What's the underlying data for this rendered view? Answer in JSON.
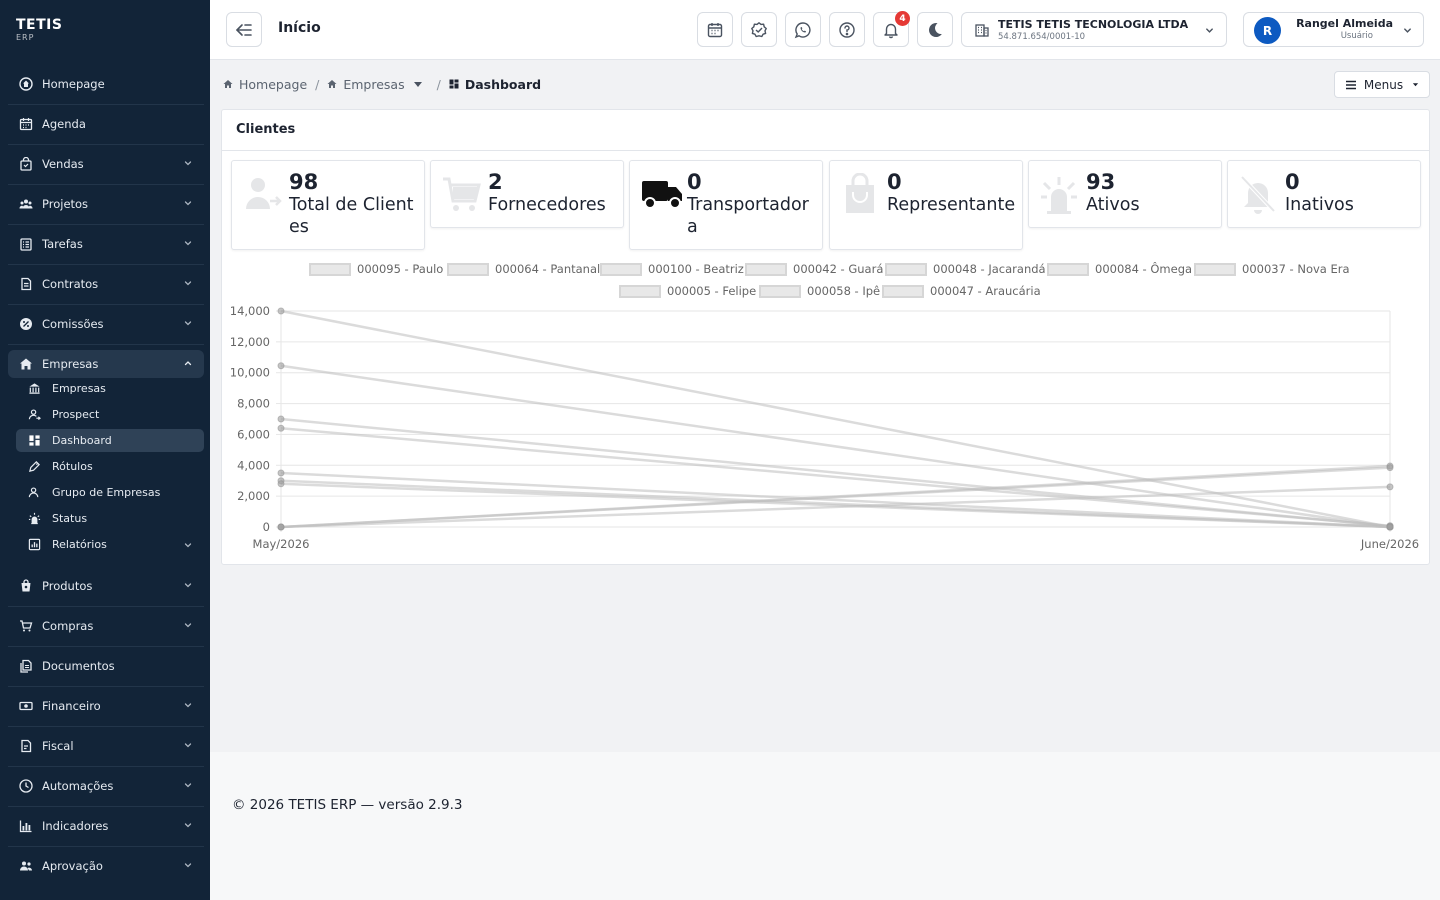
{
  "brand": {
    "name": "TETIS",
    "sub": "ERP"
  },
  "sidebar": {
    "items": [
      {
        "label": "Homepage",
        "icon": "homepage-icon"
      },
      {
        "label": "Agenda",
        "icon": "calendar-icon"
      },
      {
        "label": "Vendas",
        "icon": "shopping-bag-icon"
      },
      {
        "label": "Projetos",
        "icon": "projects-icon"
      },
      {
        "label": "Tarefas",
        "icon": "tasks-icon"
      },
      {
        "label": "Contratos",
        "icon": "contract-icon"
      },
      {
        "label": "Comissões",
        "icon": "commission-icon"
      },
      {
        "label": "Empresas",
        "icon": "company-icon"
      },
      {
        "label": "Produtos",
        "icon": "product-icon"
      },
      {
        "label": "Compras",
        "icon": "cart-icon"
      },
      {
        "label": "Documentos",
        "icon": "documents-icon"
      },
      {
        "label": "Financeiro",
        "icon": "money-icon"
      },
      {
        "label": "Fiscal",
        "icon": "fiscal-icon"
      },
      {
        "label": "Automações",
        "icon": "automation-icon"
      },
      {
        "label": "Indicadores",
        "icon": "indicators-icon"
      },
      {
        "label": "Aprovação",
        "icon": "approval-icon"
      }
    ],
    "subitems": [
      {
        "label": "Empresas",
        "icon": "building-icon"
      },
      {
        "label": "Prospect",
        "icon": "prospect-icon"
      },
      {
        "label": "Dashboard",
        "icon": "dashboard-icon"
      },
      {
        "label": "Rótulos",
        "icon": "label-icon"
      },
      {
        "label": "Grupo de Empresas",
        "icon": "group-icon"
      },
      {
        "label": "Status",
        "icon": "status-icon"
      },
      {
        "label": "Relatórios",
        "icon": "reports-icon"
      }
    ]
  },
  "topbar": {
    "title": "Início",
    "notifications_count": "4",
    "company_name": "TETIS TETIS TECNOLOGIA LTDA",
    "company_cnpj": "54.871.654/0001-10",
    "user_initial": "R",
    "user_name": "Rangel Almeida",
    "user_role": "Usuário"
  },
  "breadcrumb": {
    "home": "Homepage",
    "section": "Empresas",
    "current": "Dashboard",
    "menus_label": "Menus"
  },
  "card": {
    "title": "Clientes",
    "stats": [
      {
        "value": "98",
        "label": "Total de Clientes",
        "icon": "person-icon"
      },
      {
        "value": "2",
        "label": "Fornecedores",
        "icon": "cart-icon"
      },
      {
        "value": "0",
        "label": "Transportadora",
        "icon": "truck-icon"
      },
      {
        "value": "0",
        "label": "Representante",
        "icon": "bag-icon"
      },
      {
        "value": "93",
        "label": "Ativos",
        "icon": "siren-icon"
      },
      {
        "value": "0",
        "label": "Inativos",
        "icon": "bell-off-icon"
      }
    ]
  },
  "chart_data": {
    "type": "line",
    "x": [
      "May/2026",
      "June/2026"
    ],
    "ylim": [
      0,
      14000
    ],
    "yticks": [
      "0",
      "2,000",
      "4,000",
      "6,000",
      "8,000",
      "10,000",
      "12,000",
      "14,000"
    ],
    "legend_placement": "top",
    "grid": true,
    "series": [
      {
        "name": "000095 - Paulo",
        "values": [
          14000,
          0
        ]
      },
      {
        "name": "000064 - Pantanal",
        "values": [
          10450,
          0
        ]
      },
      {
        "name": "000100 - Beatriz",
        "values": [
          7000,
          50
        ]
      },
      {
        "name": "000042 - Guará",
        "values": [
          6400,
          80
        ]
      },
      {
        "name": "000048 - Jacarandá",
        "values": [
          3500,
          0
        ]
      },
      {
        "name": "000084 - Ômega",
        "values": [
          3000,
          0
        ]
      },
      {
        "name": "000037 - Nova Era",
        "values": [
          2800,
          0
        ]
      },
      {
        "name": "000005 - Felipe",
        "values": [
          0,
          3950
        ]
      },
      {
        "name": "000058 - Ipê",
        "values": [
          0,
          3850
        ]
      },
      {
        "name": "000047 - Araucária",
        "values": [
          0,
          2600
        ]
      }
    ]
  },
  "footer": {
    "text": "© 2026 TETIS ERP — versão 2.9.3"
  }
}
